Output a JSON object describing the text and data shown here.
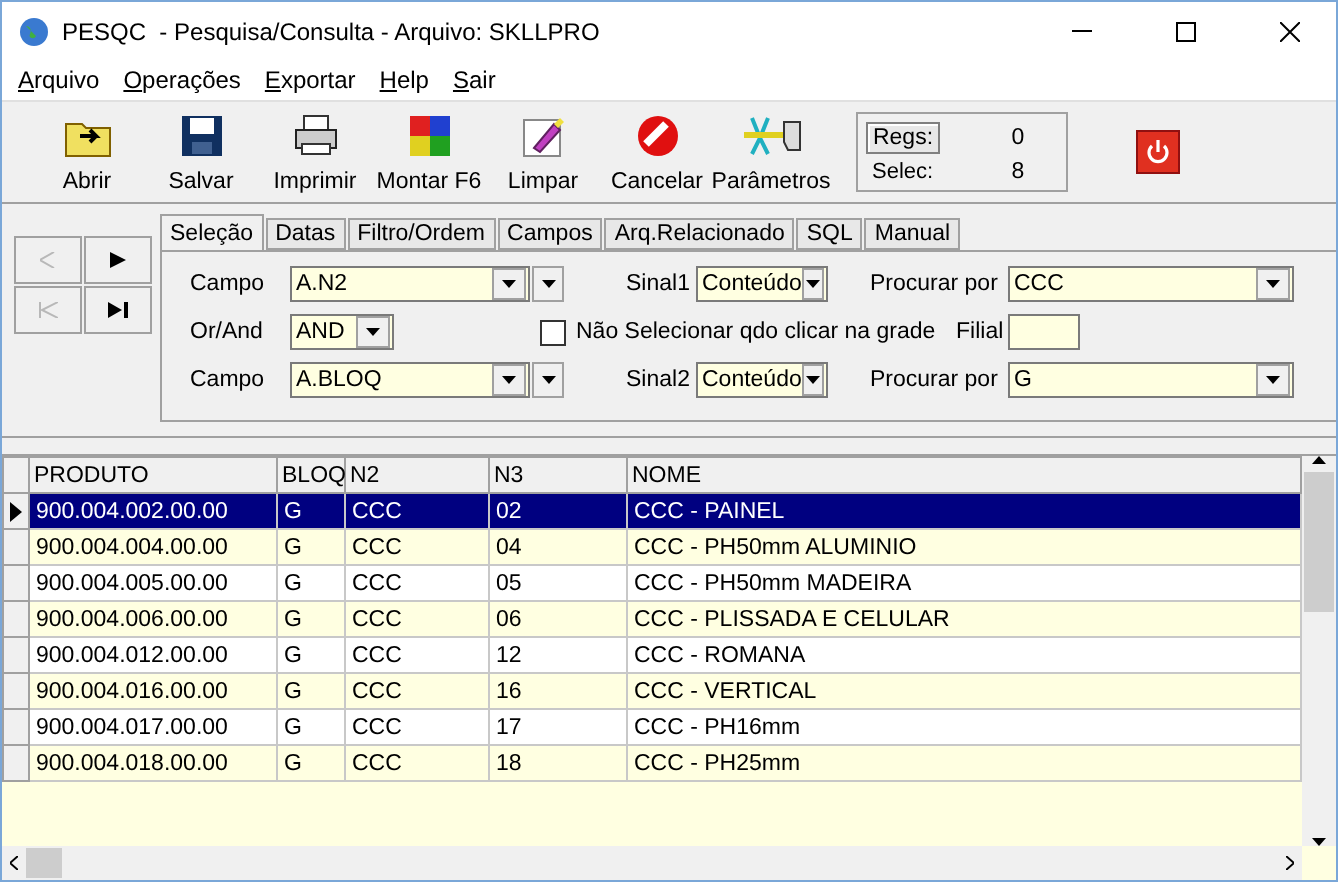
{
  "window": {
    "title": "PESQC  - Pesquisa/Consulta - Arquivo: SKLLPRO"
  },
  "menu": [
    "Arquivo",
    "Operações",
    "Exportar",
    "Help",
    "Sair"
  ],
  "toolbar": [
    {
      "kind": "open",
      "label": "Abrir"
    },
    {
      "kind": "save",
      "label": "Salvar"
    },
    {
      "kind": "print",
      "label": "Imprimir"
    },
    {
      "kind": "build",
      "label": "Montar F6"
    },
    {
      "kind": "clear",
      "label": "Limpar"
    },
    {
      "kind": "cancel",
      "label": "Cancelar"
    },
    {
      "kind": "params",
      "label": "Parâmetros"
    }
  ],
  "counters": {
    "regs_button": "Regs:",
    "regs_value": "0",
    "selec_label": "Selec:",
    "selec_value": "8"
  },
  "nav": [
    {
      "kind": "prev",
      "disabled": true
    },
    {
      "kind": "next",
      "disabled": false
    },
    {
      "kind": "first",
      "disabled": true
    },
    {
      "kind": "last",
      "disabled": false
    }
  ],
  "tabs": [
    {
      "label": "Seleção",
      "selected": true
    },
    {
      "label": "Datas",
      "selected": false
    },
    {
      "label": "Filtro/Ordem",
      "selected": false
    },
    {
      "label": "Campos",
      "selected": false
    },
    {
      "label": "Arq.Relacionado",
      "selected": false
    },
    {
      "label": "SQL",
      "selected": false
    },
    {
      "label": "Manual",
      "selected": false
    }
  ],
  "selection": {
    "row1": {
      "campo_label": "Campo",
      "campo": "A.N2",
      "sinal_label": "Sinal1",
      "sinal": "Conteúdo",
      "procurar_label": "Procurar por",
      "procurar": "CCC"
    },
    "row2": {
      "orand_label": "Or/And",
      "orand": "AND",
      "checkbox_label": "Não Selecionar qdo clicar na grade",
      "checked": false,
      "filial_label": "Filial"
    },
    "row3": {
      "campo_label": "Campo",
      "campo": "A.BLOQ",
      "sinal_label": "Sinal2",
      "sinal": "Conteúdo",
      "procurar_label": "Procurar por",
      "procurar": "G"
    }
  },
  "table": {
    "columns": [
      "PRODUTO",
      "BLOQ",
      "N2",
      "N3",
      "NOME"
    ],
    "rows": [
      {
        "cells": [
          "900.004.002.00.00",
          "G",
          "CCC",
          "02",
          "CCC - PAINEL"
        ],
        "selected": true
      },
      {
        "cells": [
          "900.004.004.00.00",
          "G",
          "CCC",
          "04",
          "CCC - PH50mm ALUMINIO"
        ],
        "selected": false
      },
      {
        "cells": [
          "900.004.005.00.00",
          "G",
          "CCC",
          "05",
          "CCC - PH50mm MADEIRA"
        ],
        "selected": false
      },
      {
        "cells": [
          "900.004.006.00.00",
          "G",
          "CCC",
          "06",
          "CCC - PLISSADA E CELULAR"
        ],
        "selected": false
      },
      {
        "cells": [
          "900.004.012.00.00",
          "G",
          "CCC",
          "12",
          "CCC - ROMANA"
        ],
        "selected": false
      },
      {
        "cells": [
          "900.004.016.00.00",
          "G",
          "CCC",
          "16",
          "CCC - VERTICAL"
        ],
        "selected": false
      },
      {
        "cells": [
          "900.004.017.00.00",
          "G",
          "CCC",
          "17",
          "CCC - PH16mm"
        ],
        "selected": false
      },
      {
        "cells": [
          "900.004.018.00.00",
          "G",
          "CCC",
          "18",
          "CCC - PH25mm"
        ],
        "selected": false
      }
    ]
  }
}
